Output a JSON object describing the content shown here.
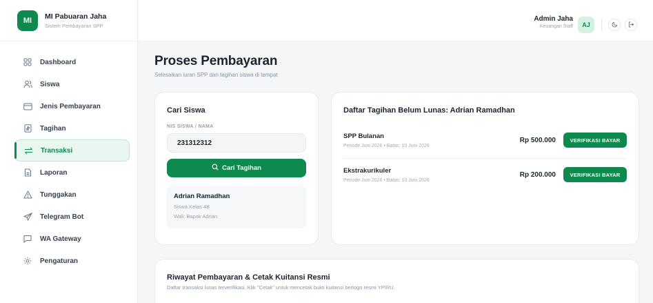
{
  "brand": {
    "logo": "MI",
    "name": "MI Pabuaran Jaha",
    "subtitle": "Sistem Pembayaran SPP"
  },
  "sidebar": {
    "items": [
      {
        "label": "Dashboard",
        "icon": "grid-icon",
        "active": false
      },
      {
        "label": "Siswa",
        "icon": "users-icon",
        "active": false
      },
      {
        "label": "Jenis Pembayaran",
        "icon": "card-icon",
        "active": false
      },
      {
        "label": "Tagihan",
        "icon": "receipt-icon",
        "active": false
      },
      {
        "label": "Transaksi",
        "icon": "swap-icon",
        "active": true
      },
      {
        "label": "Laporan",
        "icon": "document-icon",
        "active": false
      },
      {
        "label": "Tunggakan",
        "icon": "warning-icon",
        "active": false
      },
      {
        "label": "Telegram Bot",
        "icon": "send-icon",
        "active": false
      },
      {
        "label": "WA Gateway",
        "icon": "chat-icon",
        "active": false
      },
      {
        "label": "Pengaturan",
        "icon": "gear-icon",
        "active": false
      }
    ]
  },
  "header": {
    "user_name": "Admin Jaha",
    "user_role": "Keuangan Staff",
    "avatar": "AJ"
  },
  "page": {
    "title": "Proses Pembayaran",
    "subtitle": "Selesaikan iuran SPP dan tagihan siswa di tempat"
  },
  "search": {
    "title": "Cari Siswa",
    "field_label": "NIS SISWA / NAMA",
    "value": "231312312",
    "button_label": "Cari Tagihan",
    "student": {
      "name": "Adrian Ramadhan",
      "class": "Siswa Kelas 4B",
      "guardian": "Wali: Bapak Adrian"
    }
  },
  "bills": {
    "title": "Daftar Tagihan Belum Lunas: Adrian Ramadhan",
    "items": [
      {
        "name": "SPP Bulanan",
        "meta": "Periode Juni 2026 • Batas: 10 Juni 2026",
        "amount": "Rp 500.000",
        "button": "VERIFIKASI BAYAR"
      },
      {
        "name": "Ekstrakurikuler",
        "meta": "Periode Juni 2026 • Batas: 10 Juni 2026",
        "amount": "Rp 200.000",
        "button": "VERIFIKASI BAYAR"
      }
    ]
  },
  "history": {
    "title": "Riwayat Pembayaran & Cetak Kuitansi Resmi",
    "subtitle": "Daftar transaksi lunas terverifikasi. Klik \"Cetak\" untuk mencetak bukti kuitansi berlogo resmi YPIRU."
  },
  "colors": {
    "accent": "#0f8a4f",
    "accent_light": "#e9f7f0",
    "background": "#f4f6f8"
  }
}
